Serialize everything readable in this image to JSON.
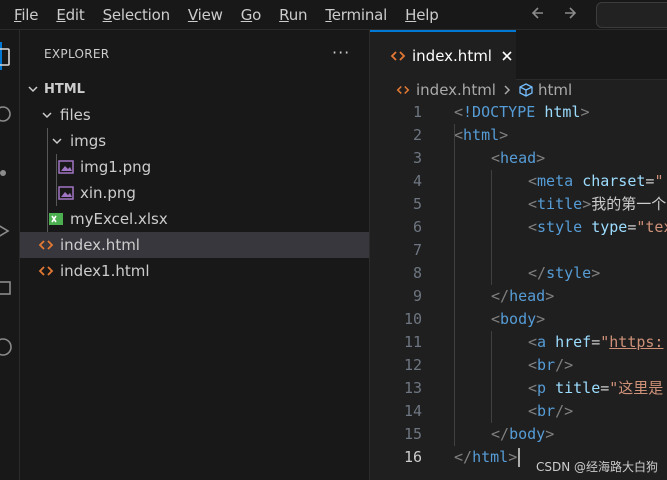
{
  "menu": {
    "items": [
      "File",
      "Edit",
      "Selection",
      "View",
      "Go",
      "Run",
      "Terminal",
      "Help"
    ],
    "mnemonics": [
      "F",
      "E",
      "S",
      "V",
      "G",
      "R",
      "T",
      "H"
    ]
  },
  "sidebar": {
    "title": "EXPLORER",
    "more_label": "···",
    "root": "HTML",
    "tree": [
      {
        "label": "files",
        "kind": "folder"
      },
      {
        "label": "imgs",
        "kind": "folder"
      },
      {
        "label": "img1.png",
        "kind": "image"
      },
      {
        "label": "xin.png",
        "kind": "image"
      },
      {
        "label": "myExcel.xlsx",
        "kind": "excel"
      },
      {
        "label": "index.html",
        "kind": "html",
        "selected": true
      },
      {
        "label": "index1.html",
        "kind": "html"
      }
    ]
  },
  "tabs": [
    {
      "label": "index.html",
      "active": true
    }
  ],
  "breadcrumb": {
    "file": "index.html",
    "symbol": "html"
  },
  "editor": {
    "current_line": "16",
    "lines": [
      {
        "n": "1",
        "tokens": [
          {
            "t": "<",
            "c": "t-br"
          },
          {
            "t": "!DOCTYPE",
            "c": "t-tag"
          },
          {
            "t": " ",
            "c": "t-txt"
          },
          {
            "t": "html",
            "c": "t-attr"
          },
          {
            "t": ">",
            "c": "t-br"
          }
        ]
      },
      {
        "n": "2",
        "tokens": [
          {
            "t": "<",
            "c": "t-br"
          },
          {
            "t": "html",
            "c": "t-tag"
          },
          {
            "t": ">",
            "c": "t-br"
          }
        ]
      },
      {
        "n": "3",
        "tokens": [
          {
            "t": "<",
            "c": "t-br"
          },
          {
            "t": "head",
            "c": "t-tag"
          },
          {
            "t": ">",
            "c": "t-br"
          }
        ]
      },
      {
        "n": "4",
        "tokens": [
          {
            "t": "<",
            "c": "t-br"
          },
          {
            "t": "meta",
            "c": "t-tag"
          },
          {
            "t": " ",
            "c": "t-txt"
          },
          {
            "t": "charset",
            "c": "t-attr"
          },
          {
            "t": "=",
            "c": "t-txt"
          },
          {
            "t": "\"",
            "c": "t-str"
          }
        ]
      },
      {
        "n": "5",
        "tokens": [
          {
            "t": "<",
            "c": "t-br"
          },
          {
            "t": "title",
            "c": "t-tag"
          },
          {
            "t": ">",
            "c": "t-br"
          },
          {
            "t": "我的第一个",
            "c": "t-txt"
          }
        ]
      },
      {
        "n": "6",
        "tokens": [
          {
            "t": "<",
            "c": "t-br"
          },
          {
            "t": "style",
            "c": "t-tag"
          },
          {
            "t": " ",
            "c": "t-txt"
          },
          {
            "t": "type",
            "c": "t-attr"
          },
          {
            "t": "=",
            "c": "t-txt"
          },
          {
            "t": "\"tex",
            "c": "t-str"
          }
        ]
      },
      {
        "n": "7",
        "tokens": []
      },
      {
        "n": "8",
        "tokens": [
          {
            "t": "</",
            "c": "t-br"
          },
          {
            "t": "style",
            "c": "t-tag"
          },
          {
            "t": ">",
            "c": "t-br"
          }
        ]
      },
      {
        "n": "9",
        "tokens": [
          {
            "t": "</",
            "c": "t-br"
          },
          {
            "t": "head",
            "c": "t-tag"
          },
          {
            "t": ">",
            "c": "t-br"
          }
        ]
      },
      {
        "n": "10",
        "tokens": [
          {
            "t": "<",
            "c": "t-br"
          },
          {
            "t": "body",
            "c": "t-tag"
          },
          {
            "t": ">",
            "c": "t-br"
          }
        ]
      },
      {
        "n": "11",
        "tokens": [
          {
            "t": "<",
            "c": "t-br"
          },
          {
            "t": "a",
            "c": "t-tag"
          },
          {
            "t": " ",
            "c": "t-txt"
          },
          {
            "t": "href",
            "c": "t-attr"
          },
          {
            "t": "=",
            "c": "t-txt"
          },
          {
            "t": "\"",
            "c": "t-str"
          },
          {
            "t": "https:",
            "c": "t-link"
          }
        ]
      },
      {
        "n": "12",
        "tokens": [
          {
            "t": "<",
            "c": "t-br"
          },
          {
            "t": "br",
            "c": "t-tag"
          },
          {
            "t": "/>",
            "c": "t-br"
          }
        ]
      },
      {
        "n": "13",
        "tokens": [
          {
            "t": "<",
            "c": "t-br"
          },
          {
            "t": "p",
            "c": "t-tag"
          },
          {
            "t": " ",
            "c": "t-txt"
          },
          {
            "t": "title",
            "c": "t-attr"
          },
          {
            "t": "=",
            "c": "t-txt"
          },
          {
            "t": "\"这里是",
            "c": "t-str"
          }
        ]
      },
      {
        "n": "14",
        "tokens": [
          {
            "t": "<",
            "c": "t-br"
          },
          {
            "t": "br",
            "c": "t-tag"
          },
          {
            "t": "/>",
            "c": "t-br"
          }
        ]
      },
      {
        "n": "15",
        "tokens": [
          {
            "t": "</",
            "c": "t-br"
          },
          {
            "t": "body",
            "c": "t-tag"
          },
          {
            "t": ">",
            "c": "t-br"
          }
        ]
      },
      {
        "n": "16",
        "tokens": [
          {
            "t": "</",
            "c": "t-br"
          },
          {
            "t": "html",
            "c": "t-tag"
          },
          {
            "t": ">",
            "c": "t-br"
          }
        ]
      }
    ]
  },
  "watermark": "CSDN @经海路大白狗",
  "colors": {
    "accent": "#0078d4",
    "html_icon": "#e37933",
    "image_icon": "#a074c4",
    "excel_icon": "#4caf50"
  }
}
